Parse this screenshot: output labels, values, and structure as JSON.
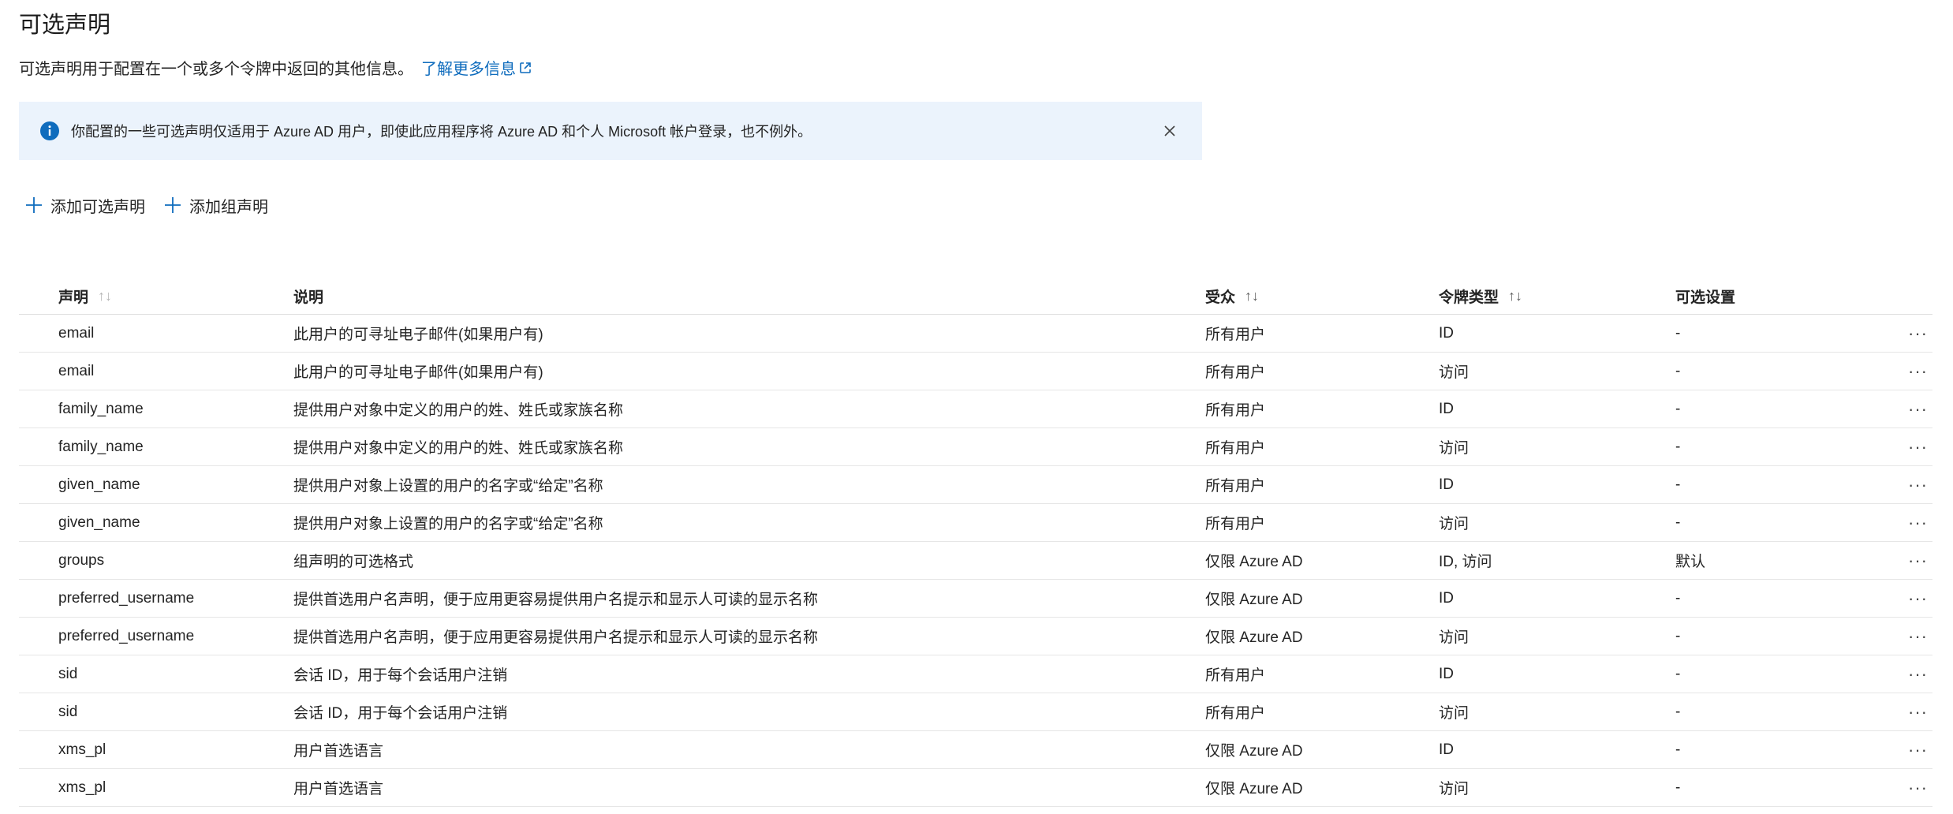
{
  "page": {
    "title": "可选声明",
    "subtitle": "可选声明用于配置在一个或多个令牌中返回的其他信息。",
    "learn_more": "了解更多信息"
  },
  "banner": {
    "message": "你配置的一些可选声明仅适用于 Azure AD 用户，即使此应用程序将 Azure AD 和个人 Microsoft 帐户登录，也不例外。"
  },
  "toolbar": {
    "add_optional_claim": "添加可选声明",
    "add_group_claim": "添加组声明"
  },
  "table": {
    "columns": {
      "claim": "声明",
      "description": "说明",
      "audience": "受众",
      "token_type": "令牌类型",
      "optional_settings": "可选设置",
      "sort_glyph": "↑↓"
    },
    "rows": [
      {
        "claim": "email",
        "description": "此用户的可寻址电子邮件(如果用户有)",
        "audience": "所有用户",
        "token_type": "ID",
        "settings": "-"
      },
      {
        "claim": "email",
        "description": "此用户的可寻址电子邮件(如果用户有)",
        "audience": "所有用户",
        "token_type": "访问",
        "settings": "-"
      },
      {
        "claim": "family_name",
        "description": "提供用户对象中定义的用户的姓、姓氏或家族名称",
        "audience": "所有用户",
        "token_type": "ID",
        "settings": "-"
      },
      {
        "claim": "family_name",
        "description": "提供用户对象中定义的用户的姓、姓氏或家族名称",
        "audience": "所有用户",
        "token_type": "访问",
        "settings": "-"
      },
      {
        "claim": "given_name",
        "description": "提供用户对象上设置的用户的名字或“给定”名称",
        "audience": "所有用户",
        "token_type": "ID",
        "settings": "-"
      },
      {
        "claim": "given_name",
        "description": "提供用户对象上设置的用户的名字或“给定”名称",
        "audience": "所有用户",
        "token_type": "访问",
        "settings": "-"
      },
      {
        "claim": "groups",
        "description": "组声明的可选格式",
        "audience": "仅限 Azure AD",
        "token_type": "ID, 访问",
        "settings": "默认"
      },
      {
        "claim": "preferred_username",
        "description": "提供首选用户名声明，便于应用更容易提供用户名提示和显示人可读的显示名称",
        "audience": "仅限 Azure AD",
        "token_type": "ID",
        "settings": "-"
      },
      {
        "claim": "preferred_username",
        "description": "提供首选用户名声明，便于应用更容易提供用户名提示和显示人可读的显示名称",
        "audience": "仅限 Azure AD",
        "token_type": "访问",
        "settings": "-"
      },
      {
        "claim": "sid",
        "description": "会话 ID，用于每个会话用户注销",
        "audience": "所有用户",
        "token_type": "ID",
        "settings": "-"
      },
      {
        "claim": "sid",
        "description": "会话 ID，用于每个会话用户注销",
        "audience": "所有用户",
        "token_type": "访问",
        "settings": "-"
      },
      {
        "claim": "xms_pl",
        "description": "用户首选语言",
        "audience": "仅限 Azure AD",
        "token_type": "ID",
        "settings": "-"
      },
      {
        "claim": "xms_pl",
        "description": "用户首选语言",
        "audience": "仅限 Azure AD",
        "token_type": "访问",
        "settings": "-"
      }
    ],
    "row_menu_glyph": "···"
  },
  "colors": {
    "accent": "#0f6cbd",
    "banner_bg": "#ebf3fc",
    "info_icon": "#0f6cbd"
  },
  "icons": {
    "info": "info-icon",
    "close": "close-icon",
    "add": "plus-icon",
    "external_link": "external-link-icon",
    "more": "more-icon"
  }
}
